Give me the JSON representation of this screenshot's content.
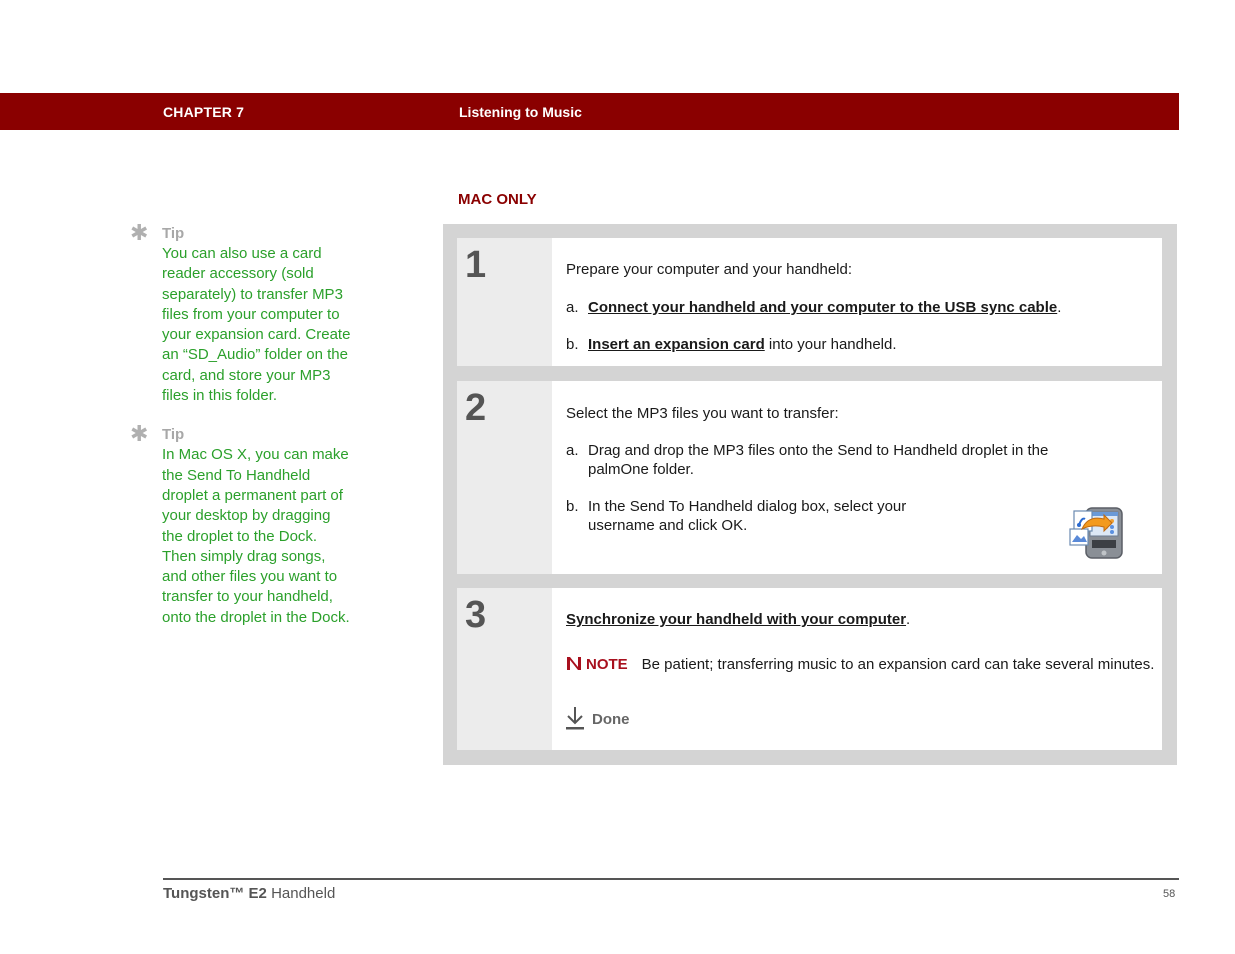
{
  "header": {
    "chapter": "CHAPTER 7",
    "title": "Listening to Music",
    "bar_color": "#8a0000"
  },
  "sidebar": {
    "tips": [
      {
        "icon": "asterisk-icon",
        "label": "Tip",
        "body": "You can also use a card reader accessory (sold separately) to transfer MP3 files from your computer to your expansion card. Create an “SD_Audio” folder on the card, and store your MP3 files in this folder."
      },
      {
        "icon": "asterisk-icon",
        "label": "Tip",
        "body": "In Mac OS X, you can make the Send To Handheld droplet a permanent part of your desktop by dragging the droplet to the Dock. Then simply drag songs, and other files you want to transfer to your handheld, onto the droplet in the Dock."
      }
    ]
  },
  "main": {
    "section_label": "MAC ONLY",
    "steps": [
      {
        "number": "1",
        "intro": "Prepare your computer and your handheld:",
        "items": [
          {
            "marker": "a.",
            "link": "Connect your handheld and your computer to the USB sync cable",
            "after": "."
          },
          {
            "marker": "b.",
            "link": "Insert an expansion card",
            "after": " into your handheld."
          }
        ]
      },
      {
        "number": "2",
        "intro": "Select the MP3 files you want to transfer:",
        "items": [
          {
            "marker": "a.",
            "line1": "Drag and drop the MP3 files onto the Send to Handheld droplet in the",
            "line2": "palmOne folder."
          },
          {
            "marker": "b.",
            "line1": "In the Send To Handheld dialog box, select your",
            "line2": "username and click OK."
          }
        ],
        "image": "send-to-handheld-droplet-icon"
      },
      {
        "number": "3",
        "link": "Synchronize your handheld with your computer",
        "after": ".",
        "note": {
          "icon": "note-icon",
          "label": "NOTE",
          "text": "Be patient; transferring music to an expansion card can take several minutes."
        },
        "done": {
          "icon": "done-arrow-icon",
          "label": "Done"
        }
      }
    ]
  },
  "footer": {
    "product_bold": "Tungsten™ E2",
    "product_rest": " Handheld",
    "page_number": "58"
  }
}
